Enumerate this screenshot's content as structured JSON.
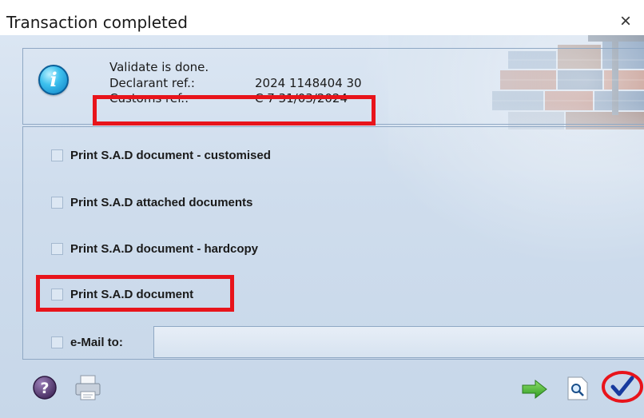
{
  "window": {
    "title": "Transaction completed",
    "close_symbol": "×"
  },
  "info": {
    "status": "Validate is done.",
    "declarant_ref_label": "Declarant ref.:",
    "declarant_ref_value": "2024 1148404 30",
    "customs_ref_label": "Customs ref.:",
    "customs_ref_value": "C 7 31/03/2024",
    "icon": "info-icon"
  },
  "options": [
    {
      "label": "Print S.A.D document - customised",
      "checked": false
    },
    {
      "label": "Print S.A.D attached documents",
      "checked": false
    },
    {
      "label": "Print S.A.D document - hardcopy",
      "checked": false
    },
    {
      "label": "Print S.A.D document",
      "checked": false
    }
  ],
  "email": {
    "label": "e-Mail to:",
    "checked": false,
    "value": ""
  },
  "toolbar": {
    "help_icon": "question-icon",
    "printer_icon": "printer-icon",
    "next_icon": "arrow-right-icon",
    "preview_icon": "magnifier-page-icon",
    "confirm_icon": "checkmark-icon"
  },
  "colors": {
    "highlight": "#e8141b",
    "panel_border": "#8fa8c4",
    "background": "#cfdded"
  }
}
